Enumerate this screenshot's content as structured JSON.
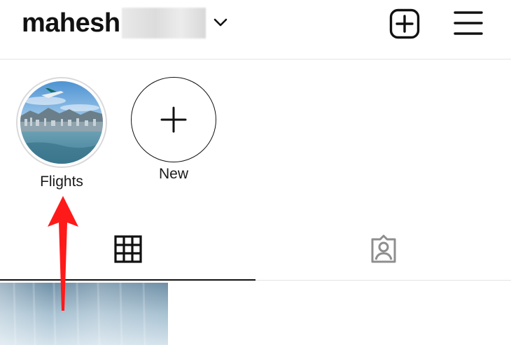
{
  "header": {
    "username": "mahesh",
    "username_suffix_redacted": true,
    "dropdown_icon": "chevron-down-icon",
    "new_post_icon": "plus-square-icon",
    "menu_icon": "hamburger-menu-icon"
  },
  "highlights": [
    {
      "label": "Flights",
      "type": "story-highlight"
    },
    {
      "label": "New",
      "type": "new-highlight"
    }
  ],
  "tabs": [
    {
      "name": "posts",
      "icon": "grid-icon",
      "active": true
    },
    {
      "name": "tagged",
      "icon": "tagged-person-icon",
      "active": false
    }
  ],
  "colors": {
    "annotation_arrow": "#ff1a1a",
    "divider": "#e3e3e3",
    "text": "#111111"
  }
}
